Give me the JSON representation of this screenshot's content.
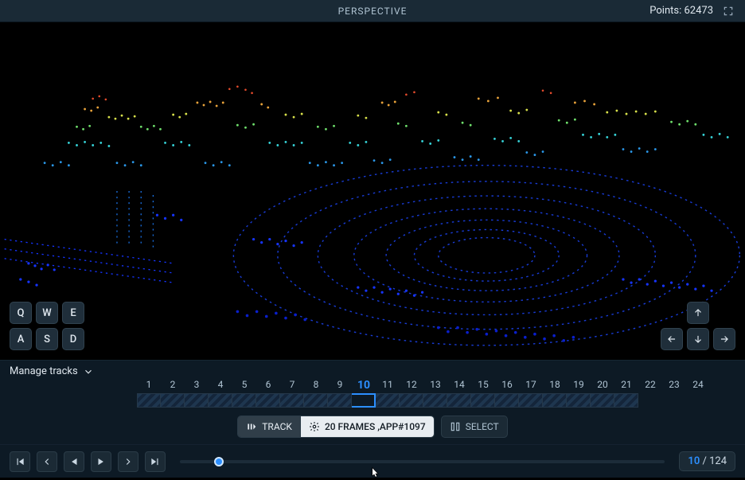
{
  "topbar": {
    "title": "PERSPECTIVE",
    "points_label": "Points:",
    "points_value": "62473"
  },
  "keypad": {
    "q": "Q",
    "w": "W",
    "e": "E",
    "a": "A",
    "s": "S",
    "d": "D"
  },
  "tracks": {
    "manage_label": "Manage tracks",
    "numbers": [
      "1",
      "2",
      "3",
      "4",
      "5",
      "6",
      "7",
      "8",
      "9",
      "10",
      "11",
      "12",
      "13",
      "14",
      "15",
      "16",
      "17",
      "18",
      "19",
      "20",
      "21",
      "22",
      "23",
      "24"
    ],
    "active_index": 9,
    "cells_count": 21
  },
  "actions": {
    "track_label": "TRACK",
    "frameset_label": "20 FRAMES ,APP#1097",
    "select_label": "SELECT"
  },
  "playback": {
    "current": "10",
    "total": "124",
    "slider_percent": 8
  }
}
